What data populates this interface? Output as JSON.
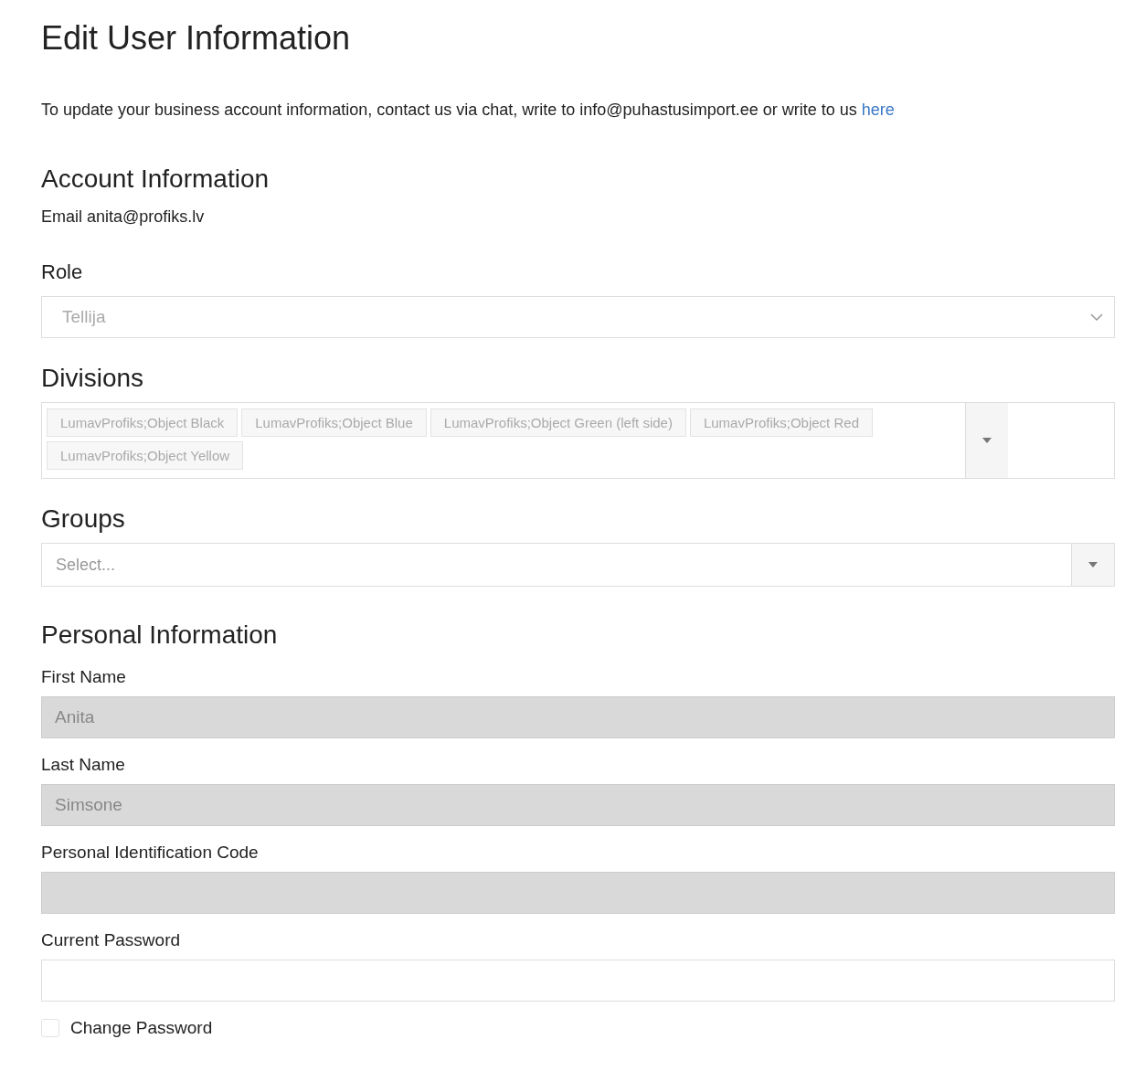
{
  "title": "Edit User Information",
  "intro": {
    "text": "To update your business account information, contact us via chat, write to info@puhastusimport.ee or write to us",
    "link": "here"
  },
  "account": {
    "heading": "Account Information",
    "email_label": "Email",
    "email": "anita@profiks.lv"
  },
  "role": {
    "label": "Role",
    "value": "Tellija"
  },
  "divisions": {
    "label": "Divisions",
    "tags": [
      "LumavProfiks;Object Black",
      "LumavProfiks;Object Blue",
      "LumavProfiks;Object Green (left side)",
      "LumavProfiks;Object Red",
      "LumavProfiks;Object Yellow"
    ]
  },
  "groups": {
    "label": "Groups",
    "placeholder": "Select..."
  },
  "personal": {
    "heading": "Personal Information",
    "fields": [
      {
        "label": "First Name",
        "value": "Anita",
        "disabled": true
      },
      {
        "label": "Last Name",
        "value": "Simsone",
        "disabled": true
      },
      {
        "label": "Personal Identification Code",
        "disabled": true
      },
      {
        "label": "Current Password",
        "disabled": false
      }
    ]
  },
  "change_password": {
    "label": "Change Password",
    "checked": false
  }
}
